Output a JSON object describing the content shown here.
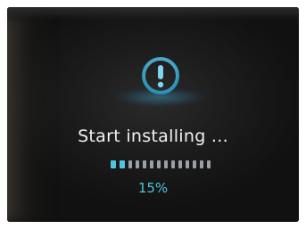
{
  "status": {
    "title": "Start installing ...",
    "progress_text": "15%",
    "progress_fraction": 0.15,
    "segments_total": 14,
    "segments_filled": 2
  },
  "icons": {
    "alert": "exclamation-circle-icon"
  },
  "colors": {
    "accent": "#4fc3e0",
    "segment_inactive": "#9aa0a6",
    "text": "#f2f2f2",
    "screen": "#1b1b1b"
  }
}
